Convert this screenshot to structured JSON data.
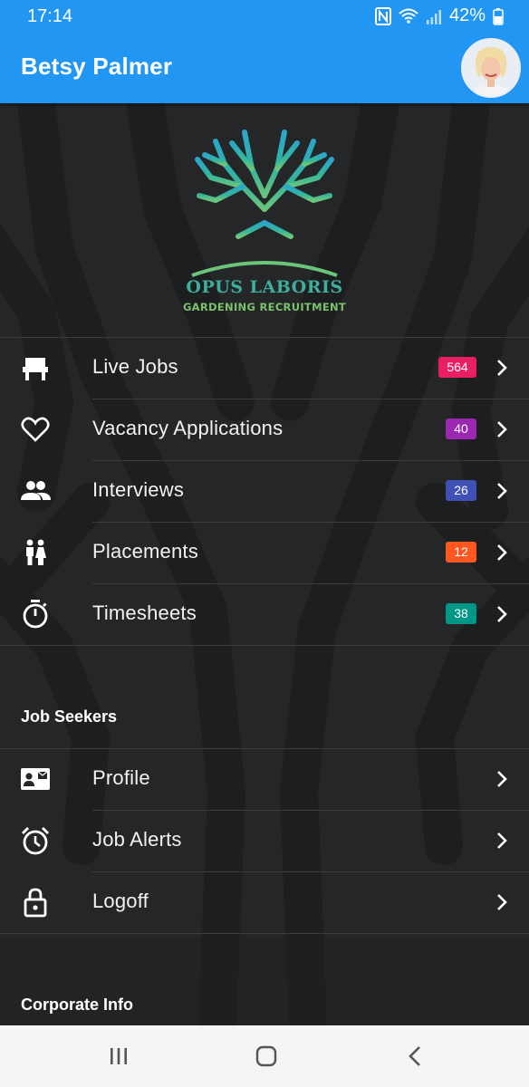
{
  "status_bar": {
    "time": "17:14",
    "battery": "42%"
  },
  "header": {
    "user_name": "Betsy Palmer"
  },
  "brand": {
    "title": "OPUS LABORIS",
    "subtitle": "GARDENING RECRUITMENT"
  },
  "menu": [
    {
      "label": "Live Jobs",
      "badge": "564",
      "badge_color": "#e91e63",
      "icon": "seat-icon"
    },
    {
      "label": "Vacancy Applications",
      "badge": "40",
      "badge_color": "#9c27b0",
      "icon": "heart-icon"
    },
    {
      "label": "Interviews",
      "badge": "26",
      "badge_color": "#3f51b5",
      "icon": "people-icon"
    },
    {
      "label": "Placements",
      "badge": "12",
      "badge_color": "#ff5722",
      "icon": "couple-icon"
    },
    {
      "label": "Timesheets",
      "badge": "38",
      "badge_color": "#009688",
      "icon": "stopwatch-icon"
    }
  ],
  "job_seekers": {
    "title": "Job Seekers",
    "items": [
      {
        "label": "Profile",
        "icon": "contact-card-icon"
      },
      {
        "label": "Job Alerts",
        "icon": "alarm-clock-icon"
      },
      {
        "label": "Logoff",
        "icon": "lock-icon"
      }
    ]
  },
  "corporate": {
    "title": "Corporate Info"
  }
}
